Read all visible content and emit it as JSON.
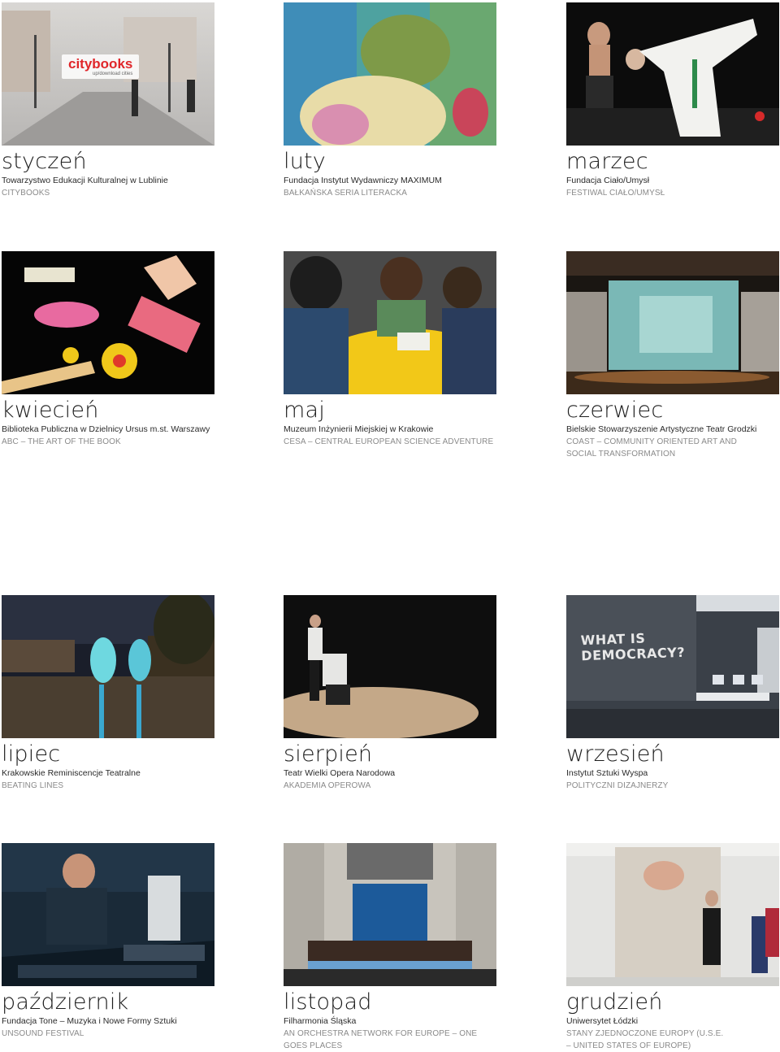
{
  "months": [
    {
      "month": "styczeń",
      "org": "Towarzystwo Edukacji Kulturalnej w Lublinie",
      "project": "CITYBOOKS",
      "logo": {
        "main": "citybooks",
        "sub": "up/download cities"
      }
    },
    {
      "month": "luty",
      "org": "Fundacja Instytut Wydawniczy MAXIMUM",
      "project": "BAŁKAŃSKA SERIA LITERACKA"
    },
    {
      "month": "marzec",
      "org": "Fundacja Ciało/Umysł",
      "project": "FESTIWAL CIAŁO/UMYSŁ"
    },
    {
      "month": "kwiecień",
      "org": "Biblioteka Publiczna w Dzielnicy Ursus m.st. Warszawy",
      "project": "ABC – THE ART OF THE BOOK"
    },
    {
      "month": "maj",
      "org": "Muzeum Inżynierii Miejskiej w Krakowie",
      "project": "CESA – CENTRAL EUROPEAN SCIENCE ADVENTURE"
    },
    {
      "month": "czerwiec",
      "org": "Bielskie Stowarzyszenie Artystyczne Teatr Grodzki",
      "project": "COAST – COMMUNITY ORIENTED ART AND SOCIAL TRANSFORMATION"
    },
    {
      "month": "lipiec",
      "org": "Krakowskie Reminiscencje Teatralne",
      "project": "BEATING LINES"
    },
    {
      "month": "sierpień",
      "org": "Teatr Wielki Opera Narodowa",
      "project": "AKADEMIA OPEROWA"
    },
    {
      "month": "wrzesień",
      "org": "Instytut Sztuki Wyspa",
      "project": "POLITYCZNI DIZAJNERZY",
      "photo_text": {
        "line1": "WHAT IS",
        "line2": "DEMOCRACY?"
      }
    },
    {
      "month": "październik",
      "org": "Fundacja Tone – Muzyka i Nowe Formy Sztuki",
      "project": "UNSOUND FESTIVAL"
    },
    {
      "month": "listopad",
      "org": "Filharmonia Śląska",
      "project": "AN ORCHESTRA NETWORK FOR EUROPE – ONE GOES PLACES"
    },
    {
      "month": "grudzień",
      "org": "Uniwersytet Łódzki",
      "project": "STANY ZJEDNOCZONE EUROPY (U.S.E. – UNITED STATES OF EUROPE)"
    }
  ]
}
